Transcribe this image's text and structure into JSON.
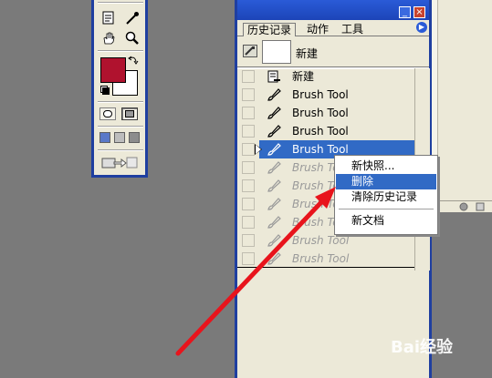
{
  "history_panel": {
    "tabs": [
      {
        "label": "历史记录",
        "active": true
      },
      {
        "label": "动作",
        "active": false
      },
      {
        "label": "工具",
        "active": false
      }
    ],
    "snapshot_label": "新建",
    "items": [
      {
        "label": "新建",
        "icon": "document-icon",
        "state": "normal"
      },
      {
        "label": "Brush Tool",
        "icon": "brush-icon",
        "state": "normal"
      },
      {
        "label": "Brush Tool",
        "icon": "brush-icon",
        "state": "normal"
      },
      {
        "label": "Brush Tool",
        "icon": "brush-icon",
        "state": "normal"
      },
      {
        "label": "Brush Tool",
        "icon": "brush-icon",
        "state": "selected"
      },
      {
        "label": "Brush Tool",
        "icon": "brush-icon",
        "state": "dimmed"
      },
      {
        "label": "Brush Tool",
        "icon": "brush-icon",
        "state": "dimmed"
      },
      {
        "label": "Brush Tool",
        "icon": "brush-icon",
        "state": "dimmed"
      },
      {
        "label": "Brush Tool",
        "icon": "brush-icon",
        "state": "dimmed"
      },
      {
        "label": "Brush Tool",
        "icon": "brush-icon",
        "state": "dimmed"
      },
      {
        "label": "Brush Tool",
        "icon": "brush-icon",
        "state": "dimmed"
      }
    ]
  },
  "context_menu": {
    "items": [
      {
        "label": "新快照...",
        "highlighted": false
      },
      {
        "label": "删除",
        "highlighted": true
      },
      {
        "label": "清除历史记录",
        "highlighted": false
      },
      {
        "label": "新文档",
        "highlighted": false
      }
    ]
  },
  "toolbox": {
    "foreground_color": "#b0122e",
    "background_color": "#ffffff"
  },
  "colors": {
    "selection": "#316ac5",
    "panel_bg": "#ece9d8",
    "titlebar": "#2a5bd7",
    "arrow": "#e8141c"
  },
  "watermark": {
    "text": "Bai经验"
  }
}
